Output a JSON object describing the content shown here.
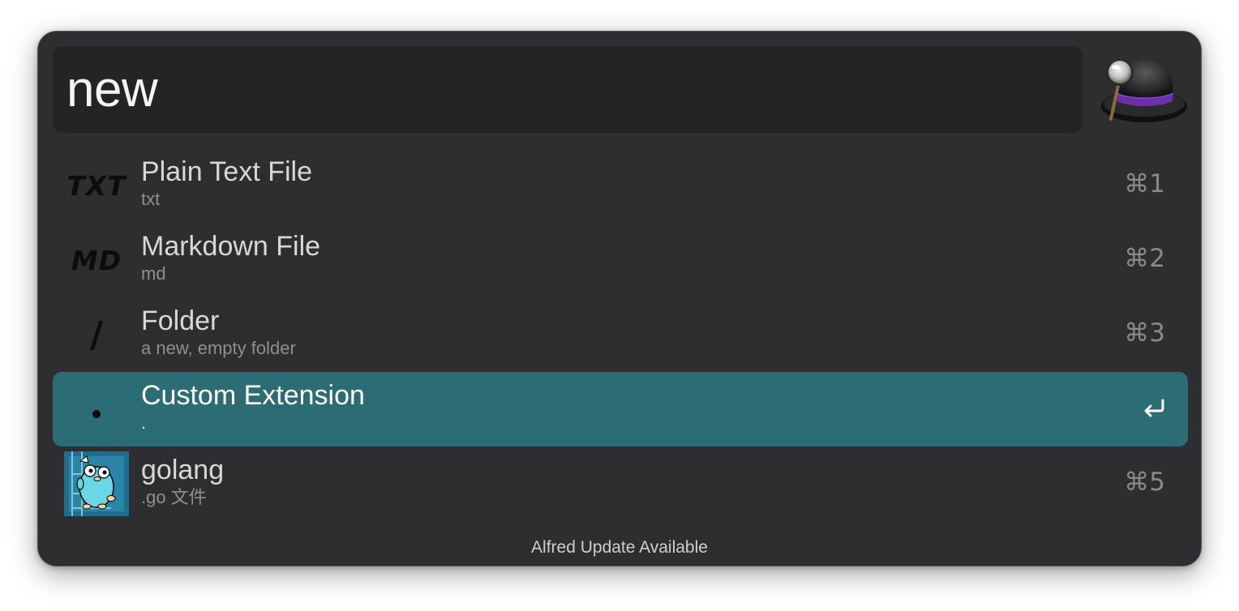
{
  "search": {
    "query": "new"
  },
  "results": [
    {
      "icon": "txt-icon",
      "icon_text": "TXT",
      "title": "Plain Text File",
      "subtitle": "txt",
      "shortcut": "⌘1"
    },
    {
      "icon": "md-icon",
      "icon_text": "MD",
      "title": "Markdown File",
      "subtitle": "md",
      "shortcut": "⌘2"
    },
    {
      "icon": "folder-slash-icon",
      "icon_text": "/",
      "title": "Folder",
      "subtitle": "a new, empty folder",
      "shortcut": "⌘3"
    },
    {
      "icon": "dot-icon",
      "title": "Custom Extension",
      "subtitle": ".",
      "shortcut_icon": "enter-icon",
      "selected": true
    },
    {
      "icon": "golang-gopher-icon",
      "title": "golang",
      "subtitle": ".go 文件",
      "shortcut": "⌘5"
    }
  ],
  "footer": {
    "text": "Alfred Update Available"
  },
  "colors": {
    "window_bg": "#2e2d2f",
    "search_bg": "#252425",
    "selected_row": "#2c6d75",
    "hat_band": "#6b2fa6"
  }
}
